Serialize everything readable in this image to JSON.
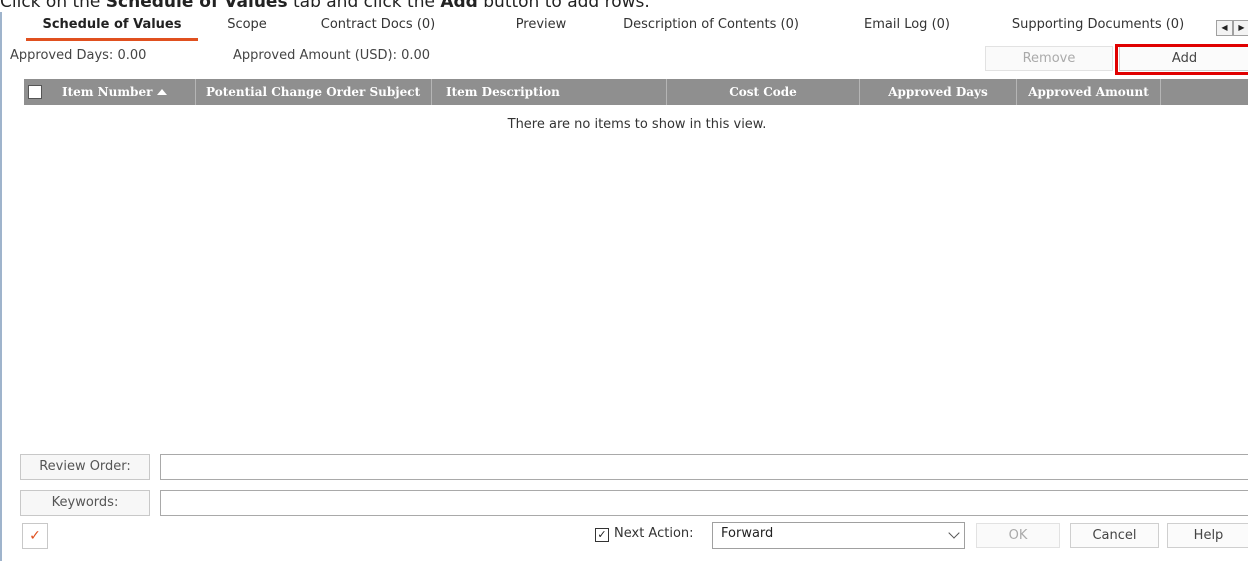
{
  "instruction": {
    "prefix": "Click on the",
    "tab_name": "Schedule of Values",
    "middle": "tab and click the",
    "button_name": "Add",
    "suffix": "button to add rows."
  },
  "tabs": [
    {
      "label": "Schedule of Values",
      "active": true
    },
    {
      "label": "Scope"
    },
    {
      "label": "Contract Docs (0)"
    },
    {
      "label": "Preview"
    },
    {
      "label": "Description of Contents (0)"
    },
    {
      "label": "Email Log (0)"
    },
    {
      "label": "Supporting Documents (0)"
    }
  ],
  "tab_scroll": {
    "left_icon": "arrow-left-icon",
    "right_icon": "arrow-right-icon",
    "left_glyph": "◀",
    "right_glyph": "▶"
  },
  "summary": {
    "approved_days": "Approved Days:  0.00",
    "approved_amount": "Approved Amount (USD):  0.00"
  },
  "actions": {
    "remove_label": "Remove",
    "add_label": "Add"
  },
  "grid": {
    "columns": [
      "Item Number",
      "Potential Change Order Subject",
      "Item Description",
      "Cost Code",
      "Approved Days",
      "Approved Amount"
    ],
    "sort_column": "Item Number",
    "sort_direction": "ascending",
    "empty_message": "There are no items to show in this view."
  },
  "form": {
    "review_order_label": "Review Order:",
    "review_order_value": "",
    "keywords_label": "Keywords:",
    "keywords_value": ""
  },
  "footer": {
    "tool_icon": "spell-check-icon",
    "tool_glyph": "✓",
    "next_action_checked": true,
    "check_glyph": "✓",
    "next_action_label": "Next Action:",
    "next_action_value": "Forward",
    "ok_label": "OK",
    "cancel_label": "Cancel",
    "help_label": "Help"
  },
  "colors": {
    "accent": "#e0501f",
    "grid_header": "#8f8f8f",
    "highlight": "#e00000",
    "frame_border": "#9fb4cc"
  }
}
